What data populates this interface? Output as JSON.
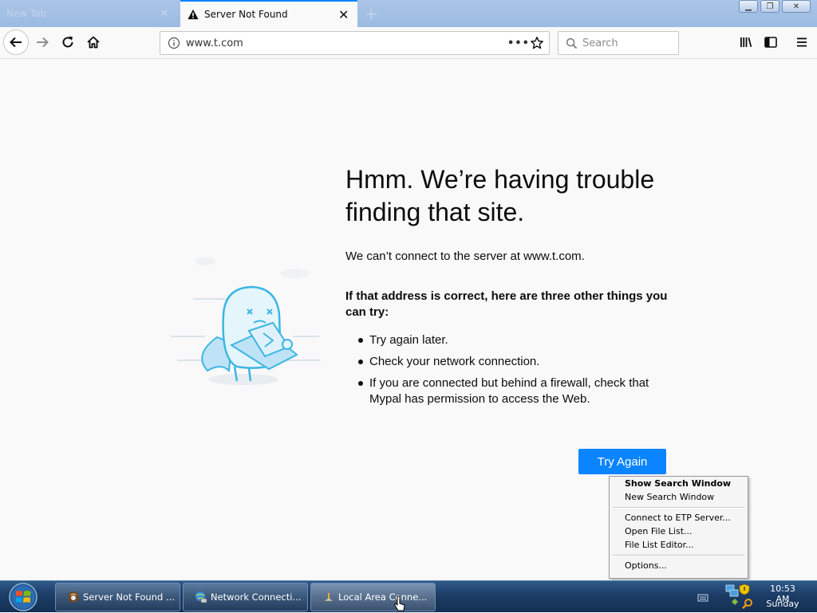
{
  "browser": {
    "tabs": [
      {
        "label": "New Tab",
        "active": false
      },
      {
        "label": "Server Not Found",
        "active": true
      }
    ],
    "url": "www.t.com",
    "search_placeholder": "Search",
    "accent_color": "#0a84ff"
  },
  "error_page": {
    "title": "Hmm. We’re having trouble finding that site.",
    "description": "We can’t connect to the server at www.t.com.",
    "suggestions_heading": "If that address is correct, here are three other things you can try:",
    "suggestions": [
      "Try again later.",
      "Check your network connection.",
      "If you are connected but behind a firewall, check that Mypal has permission to access the Web."
    ],
    "try_again_label": "Try Again"
  },
  "context_menu": {
    "items": [
      {
        "label": "Show Search Window",
        "bold": true
      },
      {
        "label": "New Search Window"
      },
      {
        "label": "Connect to ETP Server..."
      },
      {
        "label": "Open File List..."
      },
      {
        "label": "File List Editor..."
      },
      {
        "label": "Options..."
      }
    ]
  },
  "taskbar": {
    "tasks": [
      {
        "label": "Server Not Found ...",
        "icon": "browser-icon"
      },
      {
        "label": "Network Connecti...",
        "icon": "network-globe-icon"
      },
      {
        "label": "Local Area Conne...",
        "icon": "network-adapter-icon",
        "active": true
      }
    ],
    "clock_time": "10:53 AM",
    "clock_day": "Sunday"
  }
}
